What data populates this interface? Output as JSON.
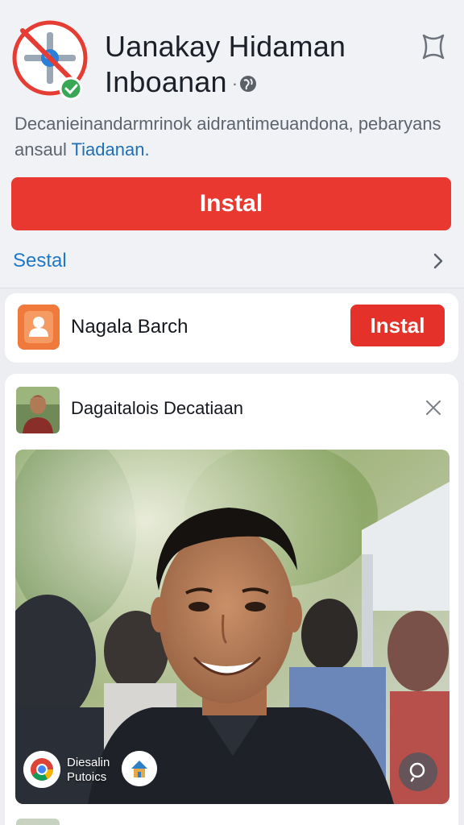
{
  "app": {
    "title_line1": "Uanakay Hidaman",
    "title_line2": "Inboanan",
    "separator": "·",
    "description_text": "Decanieinandarmrinok aidrantimeuandona, pebaryans ansaul ",
    "description_link": "Tiadanan.",
    "install_label": "Instal",
    "settings_label": "Sestal"
  },
  "suggested": {
    "title": "Nagala Barch",
    "install_label": "Instal"
  },
  "post": {
    "title": "Dagaitalois Decatiaan",
    "badge_line1": "Diesalin",
    "badge_line2": "Putoics"
  },
  "icons": {
    "app_logo": "blocked-app-logo-icon",
    "verified": "verified-check-icon",
    "globe": "globe-icon",
    "favorite": "bookmark-star-icon",
    "chevron": "chevron-right-icon",
    "close": "close-icon",
    "chrome": "chrome-icon",
    "house": "house-icon",
    "search": "search-icon"
  },
  "colors": {
    "install_red": "#e8382f",
    "link_blue": "#1f78c8",
    "suggested_icon_orange": "#f07a3b",
    "verified_green": "#3aa757"
  }
}
